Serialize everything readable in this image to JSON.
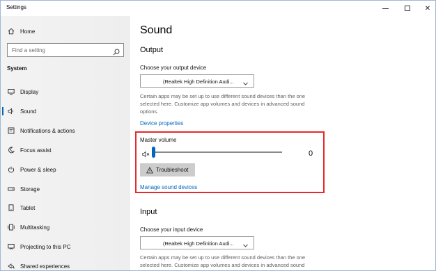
{
  "window": {
    "title": "Settings",
    "controls": {
      "minimize": "minimize",
      "maximize": "maximize",
      "close": "✕"
    }
  },
  "sidebar": {
    "home_label": "Home",
    "search_placeholder": "Find a setting",
    "section_label": "System",
    "items": [
      {
        "label": "Display",
        "icon": "display-icon",
        "active": false
      },
      {
        "label": "Sound",
        "icon": "speaker-icon",
        "active": true
      },
      {
        "label": "Notifications & actions",
        "icon": "notifications-icon",
        "active": false
      },
      {
        "label": "Focus assist",
        "icon": "moon-icon",
        "active": false
      },
      {
        "label": "Power & sleep",
        "icon": "power-icon",
        "active": false
      },
      {
        "label": "Storage",
        "icon": "storage-icon",
        "active": false
      },
      {
        "label": "Tablet",
        "icon": "tablet-icon",
        "active": false
      },
      {
        "label": "Multitasking",
        "icon": "multitasking-icon",
        "active": false
      },
      {
        "label": "Projecting to this PC",
        "icon": "projecting-icon",
        "active": false
      },
      {
        "label": "Shared experiences",
        "icon": "shared-experiences-icon",
        "active": false
      }
    ]
  },
  "main": {
    "page_title": "Sound",
    "output": {
      "heading": "Output",
      "device_label": "Choose your output device",
      "device_value": "(Realtek High Definition Audi...",
      "description": "Certain apps may be set up to use different sound devices than the one selected here. Customize app volumes and devices in advanced sound options.",
      "properties_link": "Device properties",
      "master_volume_label": "Master volume",
      "volume_value": "0",
      "volume_level": 0,
      "troubleshoot_label": "Troubleshoot",
      "manage_link": "Manage sound devices"
    },
    "input": {
      "heading": "Input",
      "device_label": "Choose your input device",
      "device_value": "(Realtek High Definition Audi...",
      "description": "Certain apps may be set up to use different sound devices than the one selected here. Customize app volumes and devices in advanced sound"
    }
  },
  "colors": {
    "accent": "#0067c0",
    "highlight_border": "#e8282a",
    "sidebar_bg": "#f0f0f0",
    "button_bg": "#cccccc"
  }
}
